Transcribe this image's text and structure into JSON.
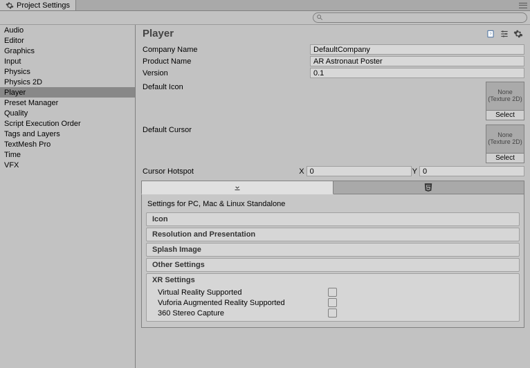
{
  "window": {
    "title": "Project Settings"
  },
  "search": {
    "placeholder": ""
  },
  "sidebar": {
    "items": [
      {
        "label": "Audio"
      },
      {
        "label": "Editor"
      },
      {
        "label": "Graphics"
      },
      {
        "label": "Input"
      },
      {
        "label": "Physics"
      },
      {
        "label": "Physics 2D"
      },
      {
        "label": "Player"
      },
      {
        "label": "Preset Manager"
      },
      {
        "label": "Quality"
      },
      {
        "label": "Script Execution Order"
      },
      {
        "label": "Tags and Layers"
      },
      {
        "label": "TextMesh Pro"
      },
      {
        "label": "Time"
      },
      {
        "label": "VFX"
      }
    ],
    "selected_index": 6
  },
  "header": {
    "title": "Player"
  },
  "form": {
    "company_label": "Company Name",
    "company_value": "DefaultCompany",
    "product_label": "Product Name",
    "product_value": "AR Astronaut Poster",
    "version_label": "Version",
    "version_value": "0.1",
    "default_icon_label": "Default Icon",
    "default_cursor_label": "Default Cursor",
    "thumb_none": "None\n(Texture 2D)",
    "select_label": "Select",
    "cursor_hotspot_label": "Cursor Hotspot",
    "hotspot_x_label": "X",
    "hotspot_x_value": "0",
    "hotspot_y_label": "Y",
    "hotspot_y_value": "0"
  },
  "platform": {
    "panel_title": "Settings for PC, Mac & Linux Standalone",
    "sections": {
      "icon": "Icon",
      "resolution": "Resolution and Presentation",
      "splash": "Splash Image",
      "other": "Other Settings",
      "xr": "XR Settings"
    },
    "xr": {
      "vr_label": "Virtual Reality Supported",
      "vr_checked": false,
      "vuforia_label": "Vuforia Augmented Reality Supported",
      "vuforia_checked": false,
      "stereo_label": "360 Stereo Capture",
      "stereo_checked": false
    }
  }
}
